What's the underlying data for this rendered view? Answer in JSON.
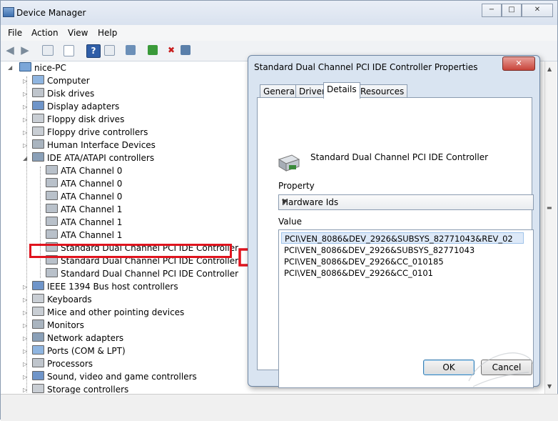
{
  "window": {
    "title": "Device Manager",
    "caption_buttons": [
      "−",
      "□",
      "✕"
    ]
  },
  "menu": [
    "File",
    "Action",
    "View",
    "Help"
  ],
  "toolbar_icons": [
    "back-icon",
    "forward-icon",
    "properties-view-icon",
    "help-icon",
    "scan-hardware-icon",
    "update-driver-icon",
    "uninstall-icon",
    "disable-icon"
  ],
  "tree": {
    "root": "nice-PC",
    "items": [
      {
        "label": "Computer",
        "level": 1,
        "expand": "▷"
      },
      {
        "label": "Disk drives",
        "level": 1,
        "expand": "▷"
      },
      {
        "label": "Display adapters",
        "level": 1,
        "expand": "▷"
      },
      {
        "label": "Floppy disk drives",
        "level": 1,
        "expand": "▷"
      },
      {
        "label": "Floppy drive controllers",
        "level": 1,
        "expand": "▷"
      },
      {
        "label": "Human Interface Devices",
        "level": 1,
        "expand": "▷"
      },
      {
        "label": "IDE ATA/ATAPI controllers",
        "level": 1,
        "expand": "◢"
      },
      {
        "label": "ATA Channel 0",
        "level": 2,
        "expand": ""
      },
      {
        "label": "ATA Channel 0",
        "level": 2,
        "expand": ""
      },
      {
        "label": "ATA Channel 0",
        "level": 2,
        "expand": ""
      },
      {
        "label": "ATA Channel 1",
        "level": 2,
        "expand": ""
      },
      {
        "label": "ATA Channel 1",
        "level": 2,
        "expand": ""
      },
      {
        "label": "ATA Channel 1",
        "level": 2,
        "expand": ""
      },
      {
        "label": "Standard Dual Channel PCI IDE Controller",
        "level": 2,
        "expand": ""
      },
      {
        "label": "Standard Dual Channel PCI IDE Controller",
        "level": 2,
        "expand": ""
      },
      {
        "label": "Standard Dual Channel PCI IDE Controller",
        "level": 2,
        "expand": ""
      },
      {
        "label": "IEEE 1394 Bus host controllers",
        "level": 1,
        "expand": "▷"
      },
      {
        "label": "Keyboards",
        "level": 1,
        "expand": "▷"
      },
      {
        "label": "Mice and other pointing devices",
        "level": 1,
        "expand": "▷"
      },
      {
        "label": "Monitors",
        "level": 1,
        "expand": "▷"
      },
      {
        "label": "Network adapters",
        "level": 1,
        "expand": "▷"
      },
      {
        "label": "Ports (COM & LPT)",
        "level": 1,
        "expand": "▷"
      },
      {
        "label": "Processors",
        "level": 1,
        "expand": "▷"
      },
      {
        "label": "Sound, video and game controllers",
        "level": 1,
        "expand": "▷"
      },
      {
        "label": "Storage controllers",
        "level": 1,
        "expand": "▷"
      }
    ]
  },
  "dialog": {
    "title": "Standard Dual Channel PCI IDE Controller Properties",
    "close": "✕",
    "tabs": [
      "General",
      "Driver",
      "Details",
      "Resources"
    ],
    "active_tab": "Details",
    "device_name": "Standard Dual Channel PCI IDE Controller",
    "property_label": "Property",
    "property_value": "Hardware Ids",
    "value_label": "Value",
    "values": [
      "PCI\\VEN_8086&DEV_2926&SUBSYS_82771043&REV_02",
      "PCI\\VEN_8086&DEV_2926&SUBSYS_82771043",
      "PCI\\VEN_8086&DEV_2926&CC_010185",
      "PCI\\VEN_8086&DEV_2926&CC_0101"
    ],
    "ok_label": "OK",
    "cancel_label": "Cancel"
  },
  "colors": {
    "highlight_box": "#e0141e",
    "selected_row": "#dde9f8"
  }
}
